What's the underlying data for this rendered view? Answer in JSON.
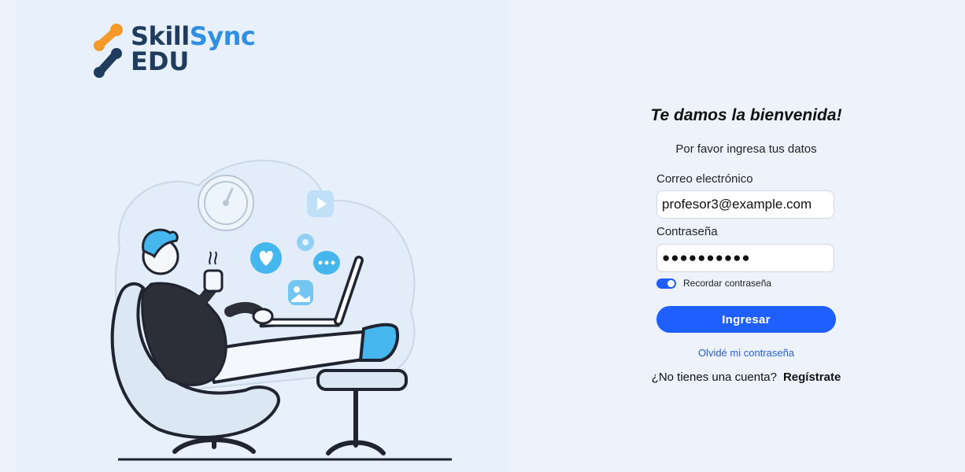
{
  "brand": {
    "line1_a": "Skill",
    "line1_b": "Sync",
    "line2": "EDU",
    "colors": {
      "dark": "#1f3c5f",
      "light": "#2f8fe3",
      "orange": "#f39a2b"
    }
  },
  "illustration": {
    "icons": [
      "clock-icon",
      "video-icon",
      "heart-icon",
      "chat-icon",
      "image-icon",
      "person-with-laptop"
    ]
  },
  "login": {
    "title": "Te damos la bienvenida!",
    "subtitle": "Por favor ingresa tus datos",
    "email_label": "Correo electrónico",
    "email_value": "profesor3@example.com",
    "password_label": "Contraseña",
    "password_value": "●●●●●●●●●●",
    "remember_label": "Recordar contraseña",
    "remember_on": true,
    "submit_label": "Ingresar",
    "forgot_label": "Olvidé mi contraseña",
    "no_account_label": "¿No tienes una cuenta?",
    "register_label": "Regístrate",
    "accent": "#1f5fff"
  }
}
